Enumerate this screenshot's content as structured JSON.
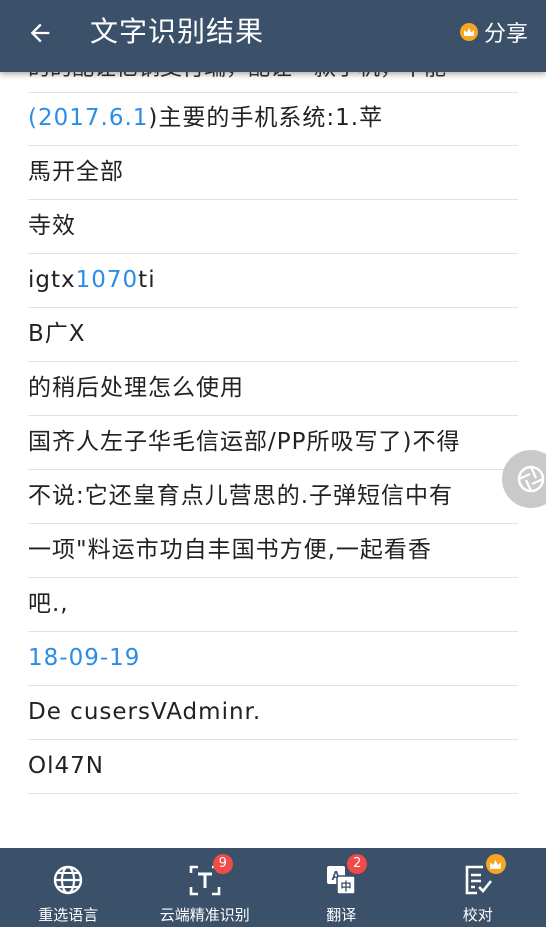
{
  "header": {
    "title": "文字识别结果",
    "share_label": "分享"
  },
  "content": {
    "cut_line": "的的配让亿钢支付端，配让一款手机，不能",
    "lines": [
      {
        "parts": [
          {
            "t": "(2017.6.1",
            "c": "blue"
          },
          {
            "t": ")主要的手机系统:1.苹",
            "c": ""
          }
        ]
      },
      {
        "parts": [
          {
            "t": "馬开全部",
            "c": ""
          }
        ]
      },
      {
        "parts": [
          {
            "t": "寺效",
            "c": ""
          }
        ]
      },
      {
        "parts": [
          {
            "t": "igtx",
            "c": ""
          },
          {
            "t": "1070",
            "c": "blue"
          },
          {
            "t": "ti",
            "c": ""
          }
        ]
      },
      {
        "parts": [
          {
            "t": "B广X",
            "c": ""
          }
        ]
      },
      {
        "parts": [
          {
            "t": "的稍后处理怎么使用",
            "c": ""
          }
        ]
      },
      {
        "parts": [
          {
            "t": "国齐人左子华毛信运部/PP所吸写了)不得",
            "c": ""
          }
        ]
      },
      {
        "parts": [
          {
            "t": "不说:它还皇育点儿营思的.子弹短信中有",
            "c": ""
          }
        ]
      },
      {
        "parts": [
          {
            "t": "一项\"料运市功自丰国书方便,一起看香",
            "c": ""
          }
        ]
      },
      {
        "parts": [
          {
            "t": "吧.,",
            "c": ""
          }
        ]
      },
      {
        "parts": [
          {
            "t": "18-09-19",
            "c": "blue"
          }
        ]
      },
      {
        "parts": [
          {
            "t": "De cusersVAdminr.",
            "c": ""
          }
        ]
      },
      {
        "parts": [
          {
            "t": "Ol47N",
            "c": ""
          }
        ]
      }
    ]
  },
  "bottom_tabs": [
    {
      "label": "重选语言",
      "icon": "globe-icon"
    },
    {
      "label": "云端精准识别",
      "icon": "cloud-ocr-icon",
      "badge": "9"
    },
    {
      "label": "翻译",
      "icon": "translate-icon",
      "badge": "2"
    },
    {
      "label": "校对",
      "icon": "proofread-icon",
      "crown": true
    }
  ],
  "colors": {
    "bar": "#3b5069",
    "blue_text": "#2b8de8",
    "badge_red": "#f04a4a",
    "crown_gold": "#f7a523"
  }
}
